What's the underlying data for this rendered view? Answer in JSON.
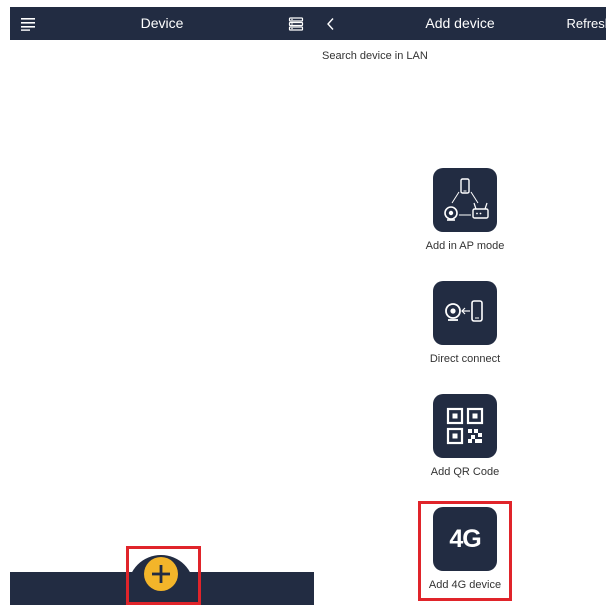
{
  "left_screen": {
    "header": {
      "title": "Device",
      "menu_icon": "hamburger-menu-icon",
      "list_icon": "device-list-icon"
    },
    "bottom_bar": {
      "add_icon": "plus-icon"
    }
  },
  "right_screen": {
    "header": {
      "title": "Add device",
      "back_icon": "chevron-left-icon",
      "refresh_label": "Refresh"
    },
    "search_label": "Search device in LAN",
    "options": [
      {
        "label": "Add in AP mode",
        "icon": "ap-mode-icon"
      },
      {
        "label": "Direct connect",
        "icon": "direct-connect-icon"
      },
      {
        "label": "Add QR Code",
        "icon": "qr-code-icon"
      },
      {
        "label": "Add 4G device",
        "icon": "4g-icon",
        "icon_text": "4G"
      }
    ]
  },
  "colors": {
    "navy": "#222c42",
    "accent_yellow": "#f3b52a",
    "highlight_red": "#e0242a"
  }
}
